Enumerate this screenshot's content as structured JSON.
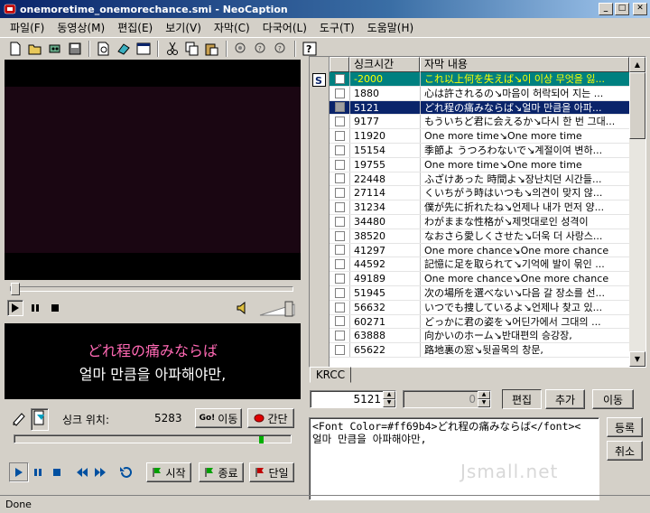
{
  "window": {
    "title": "onemoretime_onemorechance.smi - NeoCaption"
  },
  "menu": [
    "파일(F)",
    "동영상(M)",
    "편집(E)",
    "보기(V)",
    "자막(C)",
    "다국어(L)",
    "도구(T)",
    "도움말(H)"
  ],
  "toolbar": {
    "icons": [
      "new-file-icon",
      "open-folder-icon",
      "save-mask-icon",
      "save-icon",
      "preview-icon",
      "eraser-icon",
      "window-icon",
      "cut-icon",
      "copy-icon",
      "paste-icon",
      "search-icon",
      "search-next-icon",
      "search-prev-icon",
      "help-icon"
    ]
  },
  "preview": {
    "line_jp": "どれ程の痛みならば",
    "line_ko": "얼마 만큼을 아파해야만,"
  },
  "sync": {
    "label": "싱크 위치:",
    "value": "5283",
    "go_button": "이동",
    "go_prefix": "Go!",
    "interval_button": "간단"
  },
  "bottom_controls": {
    "start_button": "시작",
    "end_button": "종료",
    "single_button": "단일"
  },
  "table": {
    "columns": [
      "싱크시간",
      "자막 내용"
    ],
    "rows": [
      {
        "time": "-2000",
        "text": "これ以上何を失えば↘이 이상 무엇을 잃..."
      },
      {
        "time": "1880",
        "text": "心は許されるの↘마음이 허락되어 지는 ..."
      },
      {
        "time": "5121",
        "text": "どれ程の痛みならば↘얼마 만큼을 아파..."
      },
      {
        "time": "9177",
        "text": "もういちど君に会えるか↘다시 한 번 그대..."
      },
      {
        "time": "11920",
        "text": "One more time↘One more time"
      },
      {
        "time": "15154",
        "text": "季節よ うつろわないで↘계절이여 변하..."
      },
      {
        "time": "19755",
        "text": "One more time↘One more time"
      },
      {
        "time": "22448",
        "text": "ふざけあった 時間よ↘장난치던 시간들..."
      },
      {
        "time": "27114",
        "text": "くいちがう時はいつも↘의견이 맞지 않..."
      },
      {
        "time": "31234",
        "text": "僕が先に折れたね↘언제나 내가 먼저 양..."
      },
      {
        "time": "34480",
        "text": "わがままな性格が↘제멋대로인 성격이"
      },
      {
        "time": "38520",
        "text": "なおさら愛しくさせた↘더욱 더 사랑스..."
      },
      {
        "time": "41297",
        "text": "One more chance↘One more chance"
      },
      {
        "time": "44592",
        "text": "記憶に足を取られて↘기억에 발이 묶인 ..."
      },
      {
        "time": "49189",
        "text": "One more chance↘One more chance"
      },
      {
        "time": "51945",
        "text": "次の場所を選べない↘다음 갈 장소를 선..."
      },
      {
        "time": "56632",
        "text": "いつでも捜しているよ↘언제나 찾고 있..."
      },
      {
        "time": "60271",
        "text": "どっかに君の姿を↘어딘가에서 그대의 ..."
      },
      {
        "time": "63888",
        "text": "向かいのホーム↘반대편의 승강장,"
      },
      {
        "time": "65622",
        "text": "路地裏の窓↘뒷골목의 창문,"
      }
    ]
  },
  "lang_tab": "KRCC",
  "edit": {
    "sync_value": "5121",
    "offset_value": "0",
    "edit_button": "편집",
    "add_button": "추가",
    "move_button": "이동",
    "register_button": "등록",
    "cancel_button": "취소",
    "source_line1": "<Font Color=#ff69b4>どれ程の痛みならば</font><",
    "source_line2": "얼마 만큼을 아파해야만,"
  },
  "watermark": "Jsmall.net",
  "status": "Done"
}
